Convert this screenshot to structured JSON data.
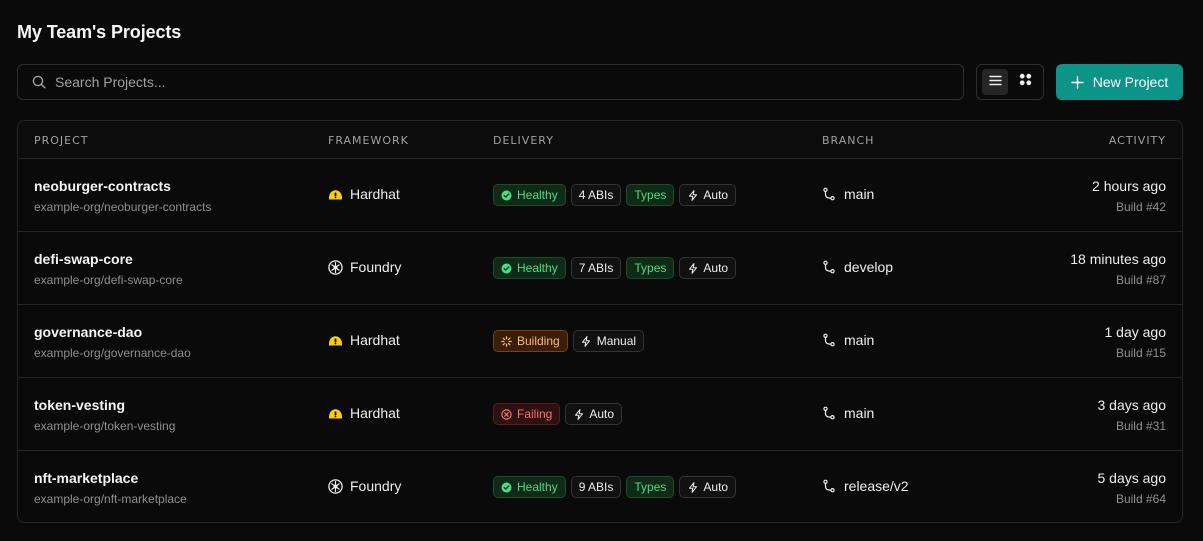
{
  "page": {
    "title": "My Team's Projects"
  },
  "search": {
    "placeholder": "Search Projects...",
    "value": ""
  },
  "toolbar": {
    "new_project_label": "New Project",
    "view_mode": "list"
  },
  "colors": {
    "accent": "#0d9488",
    "healthy": "#4ade80",
    "building": "#fdba74",
    "failing": "#f87171",
    "hardhat": "#facc15"
  },
  "table": {
    "headers": {
      "project": "PROJECT",
      "framework": "FRAMEWORK",
      "delivery": "DELIVERY",
      "branch": "BRANCH",
      "activity": "ACTIVITY"
    },
    "rows": [
      {
        "name": "neoburger-contracts",
        "repo": "example-org/neoburger-contracts",
        "framework": "Hardhat",
        "framework_icon": "hardhat-icon",
        "status": "Healthy",
        "abis": "4 ABIs",
        "types": "Types",
        "deploy": "Auto",
        "branch": "main",
        "time": "2 hours ago",
        "build": "Build #42"
      },
      {
        "name": "defi-swap-core",
        "repo": "example-org/defi-swap-core",
        "framework": "Foundry",
        "framework_icon": "foundry-icon",
        "status": "Healthy",
        "abis": "7 ABIs",
        "types": "Types",
        "deploy": "Auto",
        "branch": "develop",
        "time": "18 minutes ago",
        "build": "Build #87"
      },
      {
        "name": "governance-dao",
        "repo": "example-org/governance-dao",
        "framework": "Hardhat",
        "framework_icon": "hardhat-icon",
        "status": "Building",
        "deploy": "Manual",
        "branch": "main",
        "time": "1 day ago",
        "build": "Build #15"
      },
      {
        "name": "token-vesting",
        "repo": "example-org/token-vesting",
        "framework": "Hardhat",
        "framework_icon": "hardhat-icon",
        "status": "Failing",
        "deploy": "Auto",
        "branch": "main",
        "time": "3 days ago",
        "build": "Build #31"
      },
      {
        "name": "nft-marketplace",
        "repo": "example-org/nft-marketplace",
        "framework": "Foundry",
        "framework_icon": "foundry-icon",
        "status": "Healthy",
        "abis": "9 ABIs",
        "types": "Types",
        "deploy": "Auto",
        "branch": "release/v2",
        "time": "5 days ago",
        "build": "Build #64"
      }
    ]
  }
}
